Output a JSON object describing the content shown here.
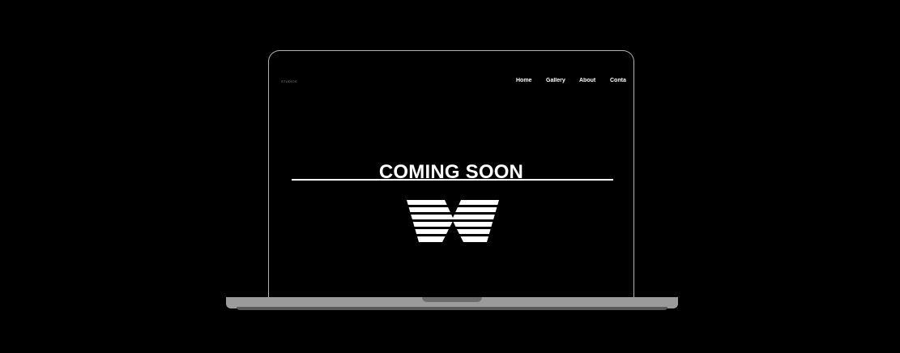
{
  "site": {
    "brand": "STUDIOS",
    "nav": {
      "home": "Home",
      "gallery": "Gallery",
      "about": "About",
      "contact": "Conta"
    },
    "headline": "COMING SOON",
    "logo_icon": "striped-w-logo-icon"
  },
  "colors": {
    "background": "#000000",
    "text": "#ffffff",
    "laptop_frame": "#b5b5b5",
    "laptop_base": "#9b9b9b"
  }
}
